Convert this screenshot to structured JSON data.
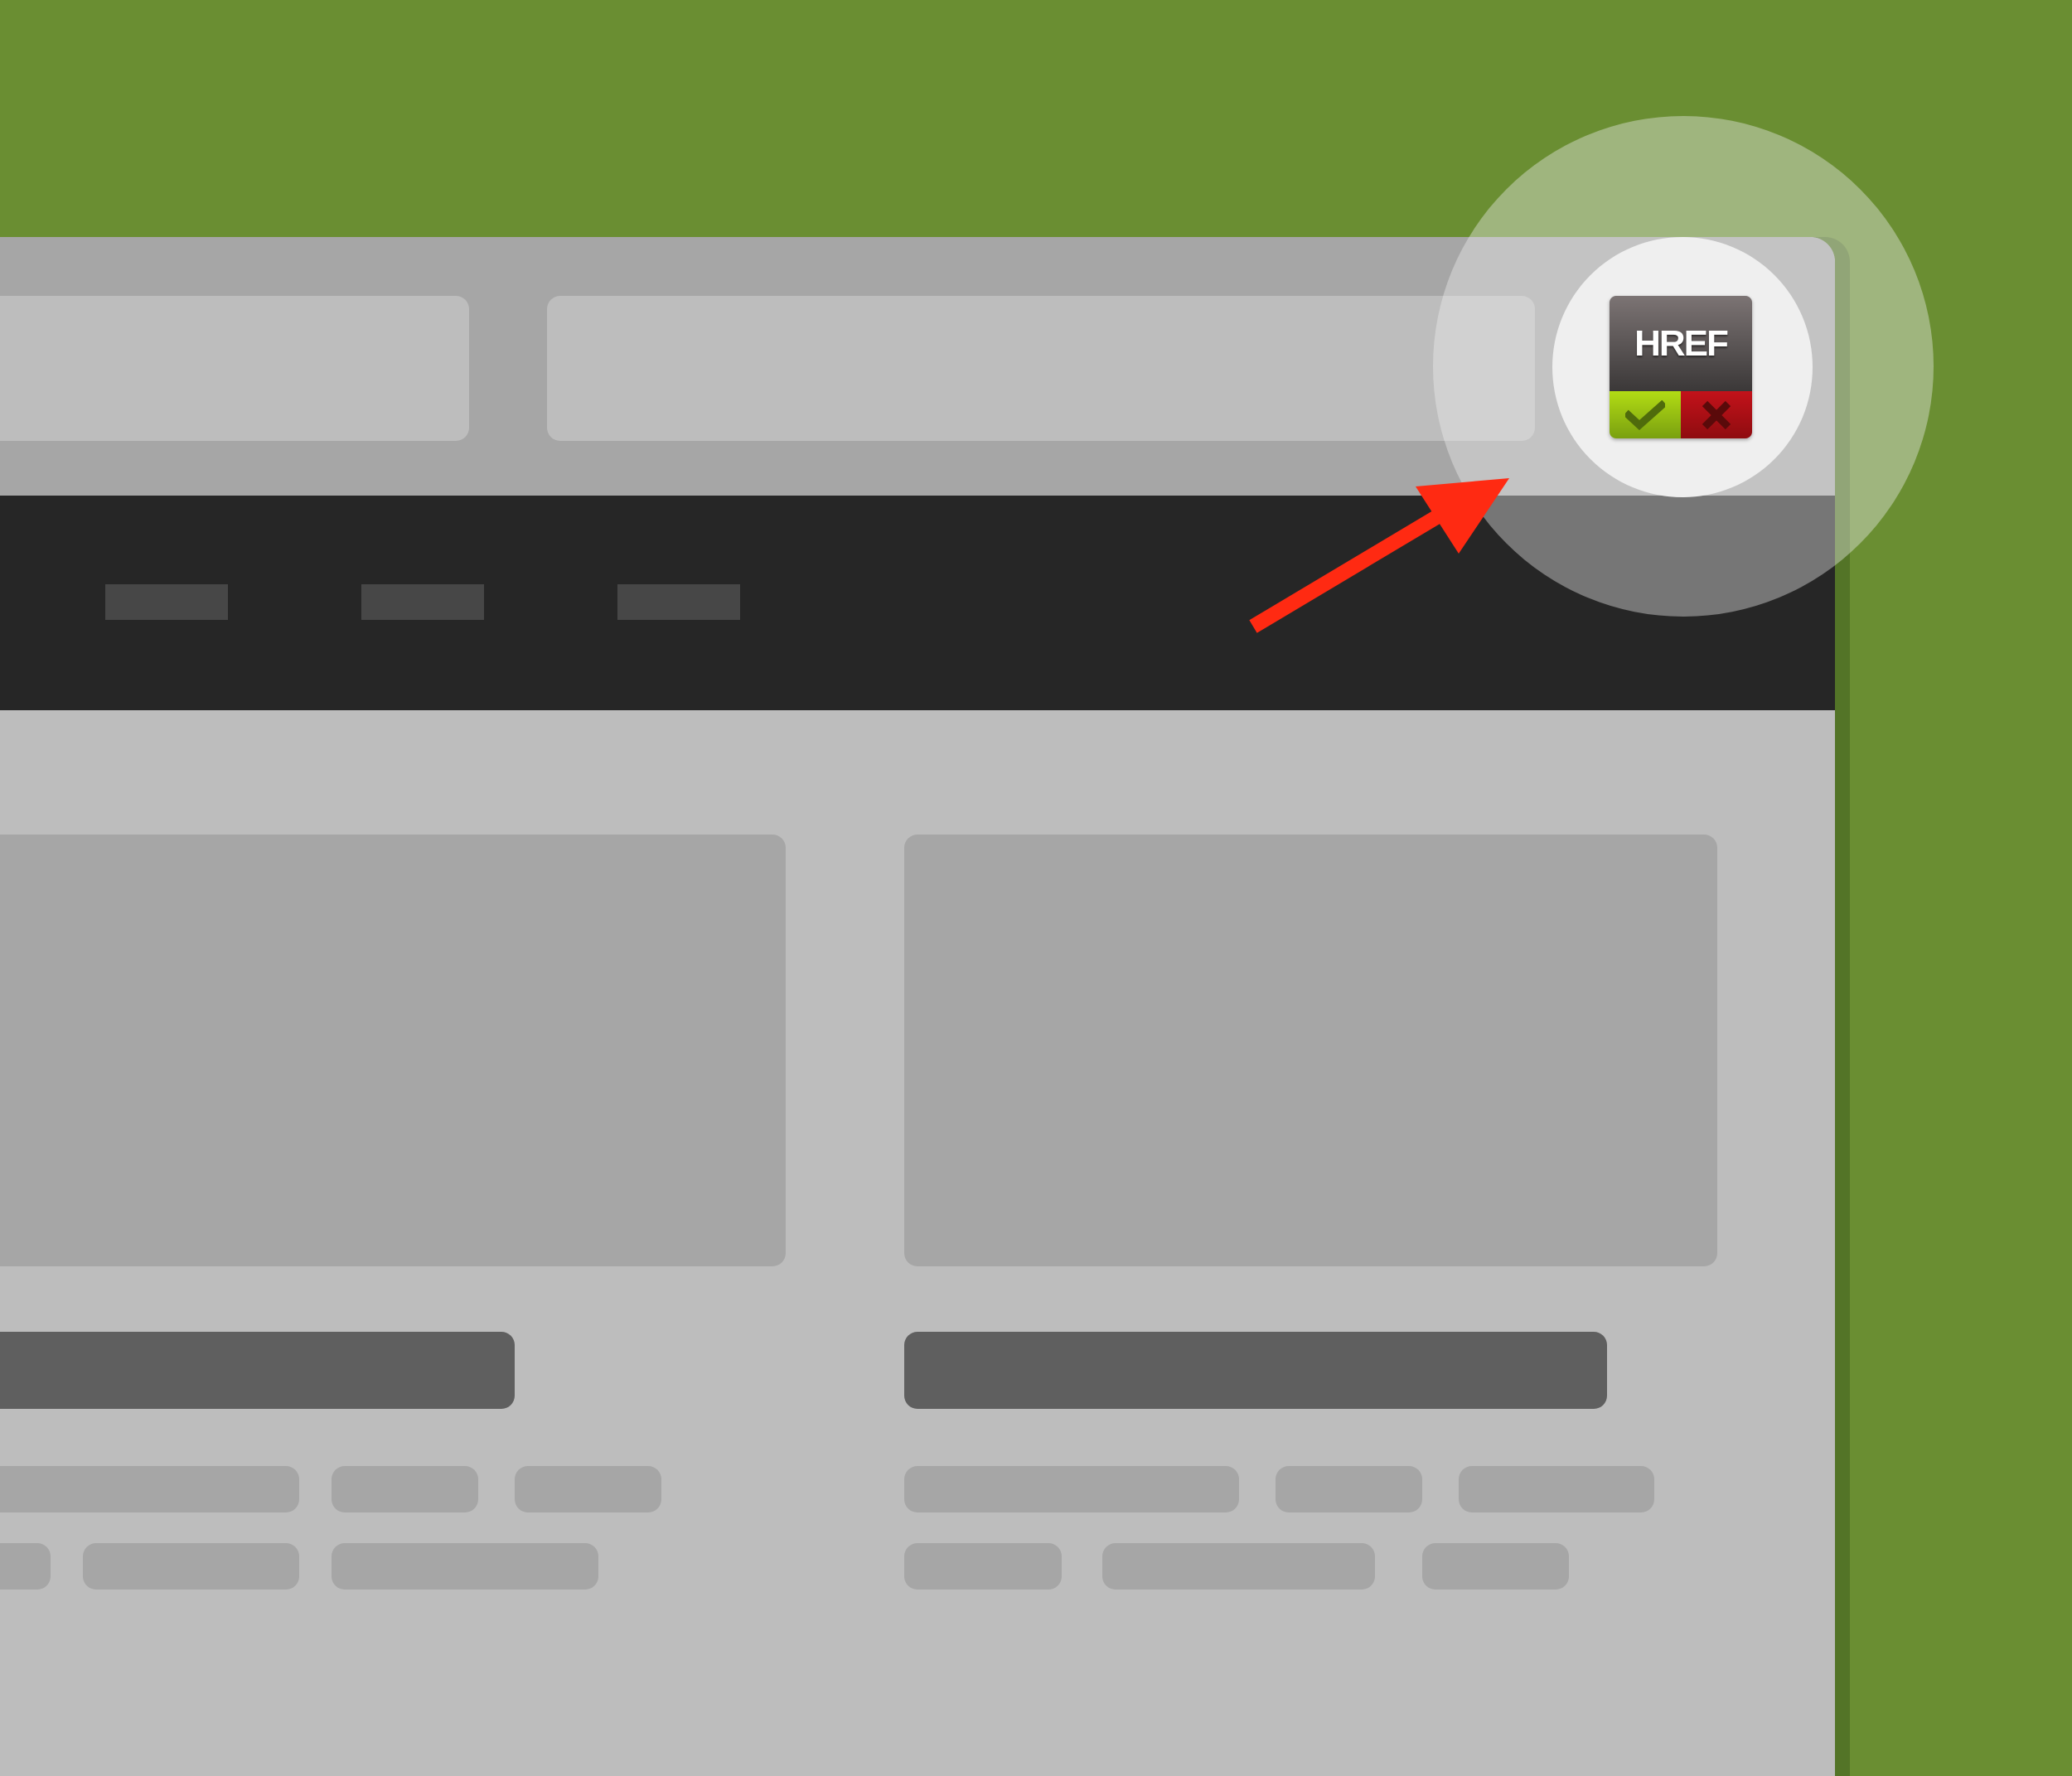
{
  "colors": {
    "background": "#6a8e32",
    "toolbar": "#a6a6a6",
    "address_field": "#bdbdbd",
    "navbar": "#262626",
    "nav_item": "#474747",
    "content": "#bdbdbd",
    "placeholder": "#a6a6a6",
    "title_placeholder": "#5f5f5f",
    "arrow": "#ff2a12"
  },
  "extension": {
    "label": "HREF",
    "ok_icon": "check-icon",
    "cancel_icon": "cross-icon"
  },
  "annotation": {
    "icon": "arrow-icon"
  }
}
